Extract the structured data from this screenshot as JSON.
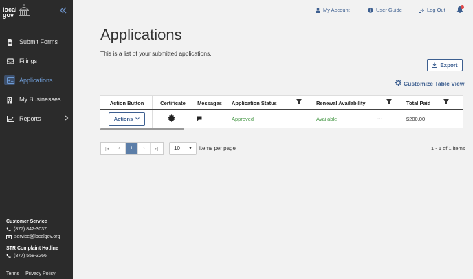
{
  "brand": {
    "logo_text_line1": "local",
    "logo_text_line2": "gov"
  },
  "sidebar": {
    "items": [
      {
        "label": "Submit Forms",
        "icon": "file-icon",
        "active": false
      },
      {
        "label": "Filings",
        "icon": "inbox-icon",
        "active": false
      },
      {
        "label": "Applications",
        "icon": "id-card-icon",
        "active": true
      },
      {
        "label": "My Businesses",
        "icon": "building-icon",
        "active": false
      },
      {
        "label": "Reports",
        "icon": "chart-icon",
        "active": false,
        "has_submenu": true
      }
    ],
    "customer_service": {
      "heading": "Customer Service",
      "phone": "(877) 842-3037",
      "email": "service@localgov.org"
    },
    "hotline": {
      "heading": "STR Complaint Hotline",
      "phone": "(877) 558-3266"
    },
    "footer_links": [
      "Terms",
      "Privacy Policy"
    ]
  },
  "topbar": {
    "my_account": "My Account",
    "user_guide": "User Guide",
    "log_out": "Log Out"
  },
  "page": {
    "title": "Applications",
    "subtitle": "This is a list of your submitted applications.",
    "export_label": "Export",
    "customize_label": "Customize Table View"
  },
  "table": {
    "headers": [
      "Action Button",
      "Certificate",
      "Messages",
      "Application Status",
      "Renewal Availability",
      "Total Paid"
    ],
    "rows": [
      {
        "action": "Actions",
        "status": "Approved",
        "renewal": "Available",
        "more": "···",
        "total_paid": "$200.00"
      }
    ]
  },
  "pagination": {
    "first": "|◂",
    "prev": "‹",
    "current_page": "1",
    "next": "›",
    "last": "▸|",
    "per_page": "10",
    "per_page_label": "items per page",
    "range": "1 - 1 of 1 items"
  },
  "colors": {
    "sidebar_bg": "#2b2b2b",
    "accent": "#3d5f90",
    "active_nav": "#6e9bd4",
    "approved_green": "#4a9a4a",
    "notification_red": "#e04b4b"
  }
}
